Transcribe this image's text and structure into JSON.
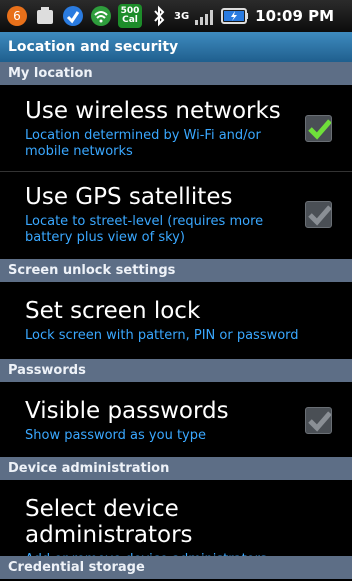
{
  "statusbar": {
    "signal_badge_top": "500",
    "signal_badge_bottom": "Cal",
    "network": "3G",
    "time": "10:09 PM"
  },
  "title": "Location and security",
  "sections": {
    "my_location": "My location",
    "screen_unlock": "Screen unlock settings",
    "passwords": "Passwords",
    "device_admin": "Device administration",
    "credential_storage": "Credential storage"
  },
  "items": {
    "wireless": {
      "title": "Use wireless networks",
      "subtitle": "Location determined by Wi-Fi and/or mobile networks",
      "checked": true
    },
    "gps": {
      "title": "Use GPS satellites",
      "subtitle": "Locate to street-level (requires more battery plus view of sky)",
      "checked": false
    },
    "screen_lock": {
      "title": "Set screen lock",
      "subtitle": "Lock screen with pattern, PIN or password"
    },
    "visible_passwords": {
      "title": "Visible passwords",
      "subtitle": "Show password as you type",
      "checked": false
    },
    "device_admins": {
      "title": "Select device administrators",
      "subtitle": "Add or remove device administrators"
    }
  },
  "colors": {
    "accent": "#3aa8ff",
    "section_bg": "#5d6e86",
    "title_bg": "#2a74a8",
    "check_green": "#6fe03a"
  }
}
